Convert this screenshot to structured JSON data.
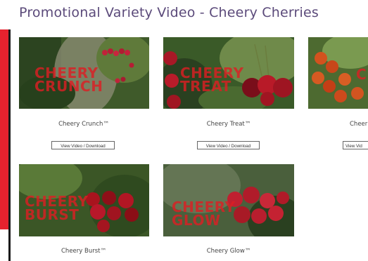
{
  "page": {
    "title": "Promotional Variety Video - Cheery Cherries"
  },
  "colors": {
    "accent_red": "#e6222e",
    "title_purple": "#5b4a7a",
    "overlay_red": "#dc1e23"
  },
  "videos": [
    {
      "name": "Cheery Crunch™",
      "overlay": [
        "CHEERY",
        "CRUNCH"
      ],
      "button": "View Video / Download"
    },
    {
      "name": "Cheery Treat™",
      "overlay": [
        "CHEERY",
        "TREAT"
      ],
      "button": "View Video / Download"
    },
    {
      "name": "Cheer",
      "overlay": [
        "C"
      ],
      "button": "View Vid"
    },
    {
      "name": "Cheery Burst™",
      "overlay": [
        "CHEERY",
        "BURST"
      ]
    },
    {
      "name": "Cheery Glow™",
      "overlay": [
        "CHEERY",
        "GLOW"
      ]
    }
  ]
}
